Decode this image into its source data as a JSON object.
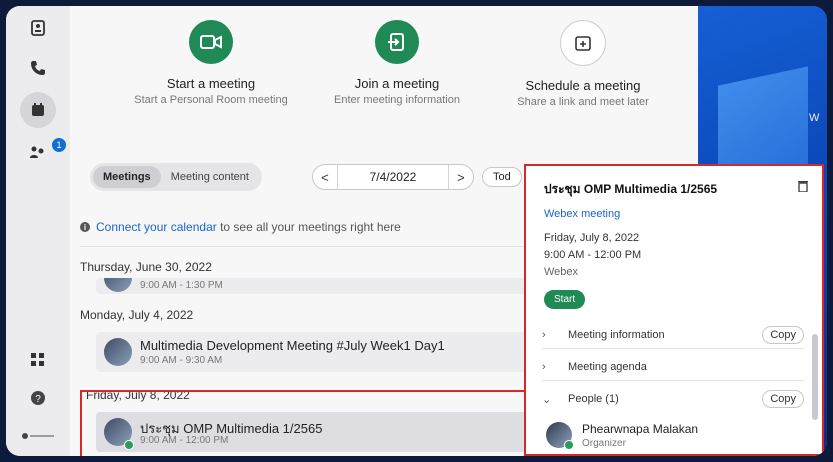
{
  "rail": {
    "badge_count": "1"
  },
  "actions": {
    "start": {
      "title": "Start a meeting",
      "subtitle": "Start a Personal Room meeting"
    },
    "join": {
      "title": "Join a meeting",
      "subtitle": "Enter meeting information"
    },
    "schedule": {
      "title": "Schedule a meeting",
      "subtitle": "Share a link and meet later"
    }
  },
  "toolbar": {
    "tabs": [
      "Meetings",
      "Meeting content"
    ],
    "active_tab": "Meetings",
    "date": "7/4/2022",
    "prev": "<",
    "next": ">",
    "today_label": "Tod"
  },
  "calendar_note": {
    "link_text": "Connect your calendar",
    "rest_text": " to see all your meetings right here"
  },
  "days": [
    {
      "header": "Thursday, June 30, 2022",
      "meetings": [
        {
          "time": "9:00 AM - 1:30 PM"
        }
      ]
    },
    {
      "header": "Monday, July 4, 2022",
      "meetings": [
        {
          "title": "Multimedia Development Meeting #July Week1 Day1",
          "time": "9:00 AM - 9:30 AM"
        }
      ]
    },
    {
      "header": "Friday, July 8, 2022",
      "meetings": [
        {
          "title": "ประชุม OMP Multimedia 1/2565",
          "time": "9:00 AM - 12:00 PM"
        }
      ]
    }
  ],
  "panel": {
    "title": "ประชุม OMP Multimedia 1/2565",
    "link": "Webex meeting",
    "date": "Friday, July 8, 2022",
    "time": "9:00 AM - 12:00 PM",
    "platform": "Webex",
    "start_label": "Start",
    "rows": [
      {
        "label": "Meeting information",
        "copy": "Copy"
      },
      {
        "label": "Meeting agenda"
      },
      {
        "label": "People (1)",
        "copy": "Copy"
      }
    ],
    "person": {
      "name": "Phearwnapa Malakan",
      "role": "Organizer"
    }
  },
  "desktop": {
    "partial_text": "W"
  },
  "colors": {
    "accent_green": "#1f8a55",
    "highlight_red": "#d62828",
    "link_blue": "#1a65c5"
  }
}
